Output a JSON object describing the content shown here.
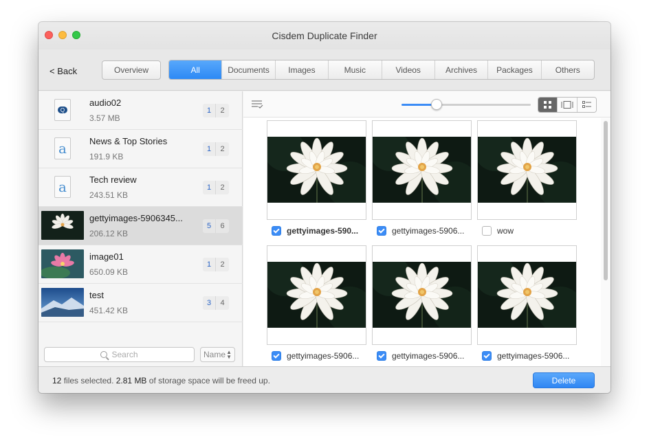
{
  "window": {
    "title": "Cisdem Duplicate Finder"
  },
  "toolbar": {
    "back_label": "< Back",
    "overview_label": "Overview",
    "tabs": [
      "All",
      "Documents",
      "Images",
      "Music",
      "Videos",
      "Archives",
      "Packages",
      "Others"
    ],
    "active_tab": "All"
  },
  "files": [
    {
      "name": "audio02",
      "size": "3.57 MB",
      "count_a": "1",
      "count_b": "2",
      "icon": "quicktime-doc-icon"
    },
    {
      "name": "News & Top Stories",
      "size": "191.9 KB",
      "count_a": "1",
      "count_b": "2",
      "icon": "text-doc-icon"
    },
    {
      "name": "Tech review",
      "size": "243.51 KB",
      "count_a": "1",
      "count_b": "2",
      "icon": "text-doc-icon"
    },
    {
      "name": "gettyimages-5906345...",
      "size": "206.12 KB",
      "count_a": "5",
      "count_b": "6",
      "icon": "lotus-thumbnail",
      "selected": true
    },
    {
      "name": "image01",
      "size": "650.09 KB",
      "count_a": "1",
      "count_b": "2",
      "icon": "pink-flower-thumbnail"
    },
    {
      "name": "test",
      "size": "451.42 KB",
      "count_a": "3",
      "count_b": "4",
      "icon": "mountain-thumbnail"
    }
  ],
  "search": {
    "placeholder": "Search"
  },
  "sort": {
    "label": "Name"
  },
  "view": {
    "zoom": 0.27,
    "modes": [
      "grid-view-icon",
      "filmstrip-view-icon",
      "list-view-icon"
    ],
    "active_mode": "grid-view-icon"
  },
  "grid_items": [
    {
      "label": "gettyimages-590...",
      "checked": true,
      "bold": true
    },
    {
      "label": "gettyimages-5906...",
      "checked": true,
      "bold": false
    },
    {
      "label": "wow",
      "checked": false,
      "bold": false
    },
    {
      "label": "gettyimages-5906...",
      "checked": true,
      "bold": false
    },
    {
      "label": "gettyimages-5906...",
      "checked": true,
      "bold": false
    },
    {
      "label": "gettyimages-5906...",
      "checked": true,
      "bold": false
    }
  ],
  "status": {
    "files_count": "12",
    "files_text": "files selected.",
    "space": "2.81 MB",
    "space_text": "of storage space will be freed up."
  },
  "actions": {
    "delete_label": "Delete"
  },
  "colors": {
    "accent": "#3b8cf6",
    "selected_row": "#dcdcdc"
  }
}
